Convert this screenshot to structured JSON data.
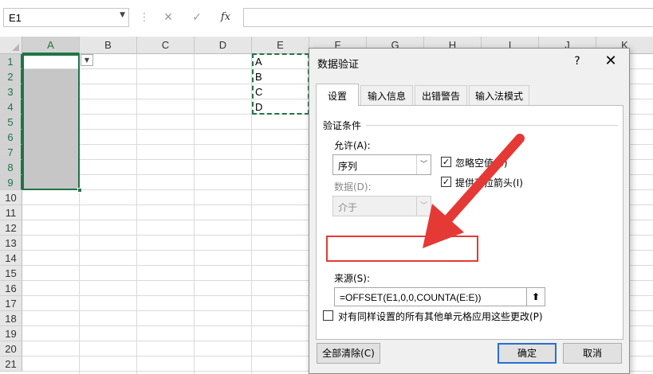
{
  "formula_bar": {
    "name_box": "E1",
    "cancel_icon": "✕",
    "enter_icon": "✓",
    "fx_label": "fx",
    "formula": ""
  },
  "grid": {
    "columns": [
      "A",
      "B",
      "C",
      "D",
      "E",
      "F",
      "G",
      "H",
      "I",
      "J",
      "K"
    ],
    "rows": [
      "1",
      "2",
      "3",
      "4",
      "5",
      "6",
      "7",
      "8",
      "9",
      "10",
      "11",
      "12",
      "13",
      "14",
      "15",
      "16",
      "17",
      "18",
      "19",
      "20",
      "21"
    ],
    "column_e_values": [
      "A",
      "B",
      "C",
      "D"
    ]
  },
  "dialog": {
    "title": "数据验证",
    "help_label": "?",
    "close_label": "✕",
    "tabs": [
      "设置",
      "输入信息",
      "出错警告",
      "输入法模式"
    ],
    "group_label": "验证条件",
    "allow_label": "允许(A):",
    "allow_value": "序列",
    "data_label": "数据(D):",
    "data_value": "介于",
    "ignore_blank_label": "忽略空值(B)",
    "ignore_blank_checked": true,
    "dropdown_label": "提供下拉箭头(I)",
    "dropdown_checked": true,
    "source_label": "来源(S):",
    "source_value": "=OFFSET(E1,0,0,COUNTA(E:E))",
    "apply_all_label": "对有同样设置的所有其他单元格应用这些更改(P)",
    "apply_all_checked": false,
    "clear_all_label": "全部清除(C)",
    "ok_label": "确定",
    "cancel_label": "取消"
  },
  "colors": {
    "excel_green": "#217346",
    "annotation_red": "#e53935",
    "selection_gray": "#c6c6c6"
  }
}
